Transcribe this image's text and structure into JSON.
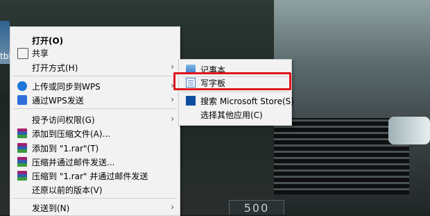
{
  "desktop": {
    "icon_label": "tbl"
  },
  "wallpaper": {
    "plate_text": "500"
  },
  "context_menu": {
    "items": [
      {
        "label": "打开(O)",
        "bold": true,
        "icon": "none",
        "submenu": false
      },
      {
        "label": "共享",
        "icon": "share-icon",
        "submenu": false
      },
      {
        "label": "打开方式(H)",
        "icon": "none",
        "submenu": true
      },
      {
        "label": "上传或同步到WPS",
        "icon": "wps-cloud-icon",
        "submenu": true
      },
      {
        "label": "通过WPS发送",
        "icon": "wps-send-icon",
        "submenu": true
      },
      {
        "label": "授予访问权限(G)",
        "icon": "none",
        "submenu": true
      },
      {
        "label": "添加到压缩文件(A)...",
        "icon": "winrar-icon",
        "submenu": false
      },
      {
        "label": "添加到 \"1.rar\"(T)",
        "icon": "winrar-icon",
        "submenu": false
      },
      {
        "label": "压缩并通过邮件发送...",
        "icon": "winrar-icon",
        "submenu": false
      },
      {
        "label": "压缩到 \"1.rar\" 并通过邮件发送",
        "icon": "winrar-icon",
        "submenu": false
      },
      {
        "label": "还原以前的版本(V)",
        "icon": "none",
        "submenu": false
      },
      {
        "label": "发送到(N)",
        "icon": "none",
        "submenu": true
      }
    ]
  },
  "open_with_submenu": {
    "items": [
      {
        "label": "记事本",
        "icon": "notepad-icon"
      },
      {
        "label": "写字板",
        "icon": "wordpad-icon",
        "highlighted": true
      },
      {
        "label": "搜索 Microsoft Store(S)",
        "icon": "store-icon"
      },
      {
        "label": "选择其他应用(C)",
        "icon": "none"
      }
    ]
  },
  "colors": {
    "menu_bg": "#f2f2f2",
    "highlight": "#e0141c"
  }
}
